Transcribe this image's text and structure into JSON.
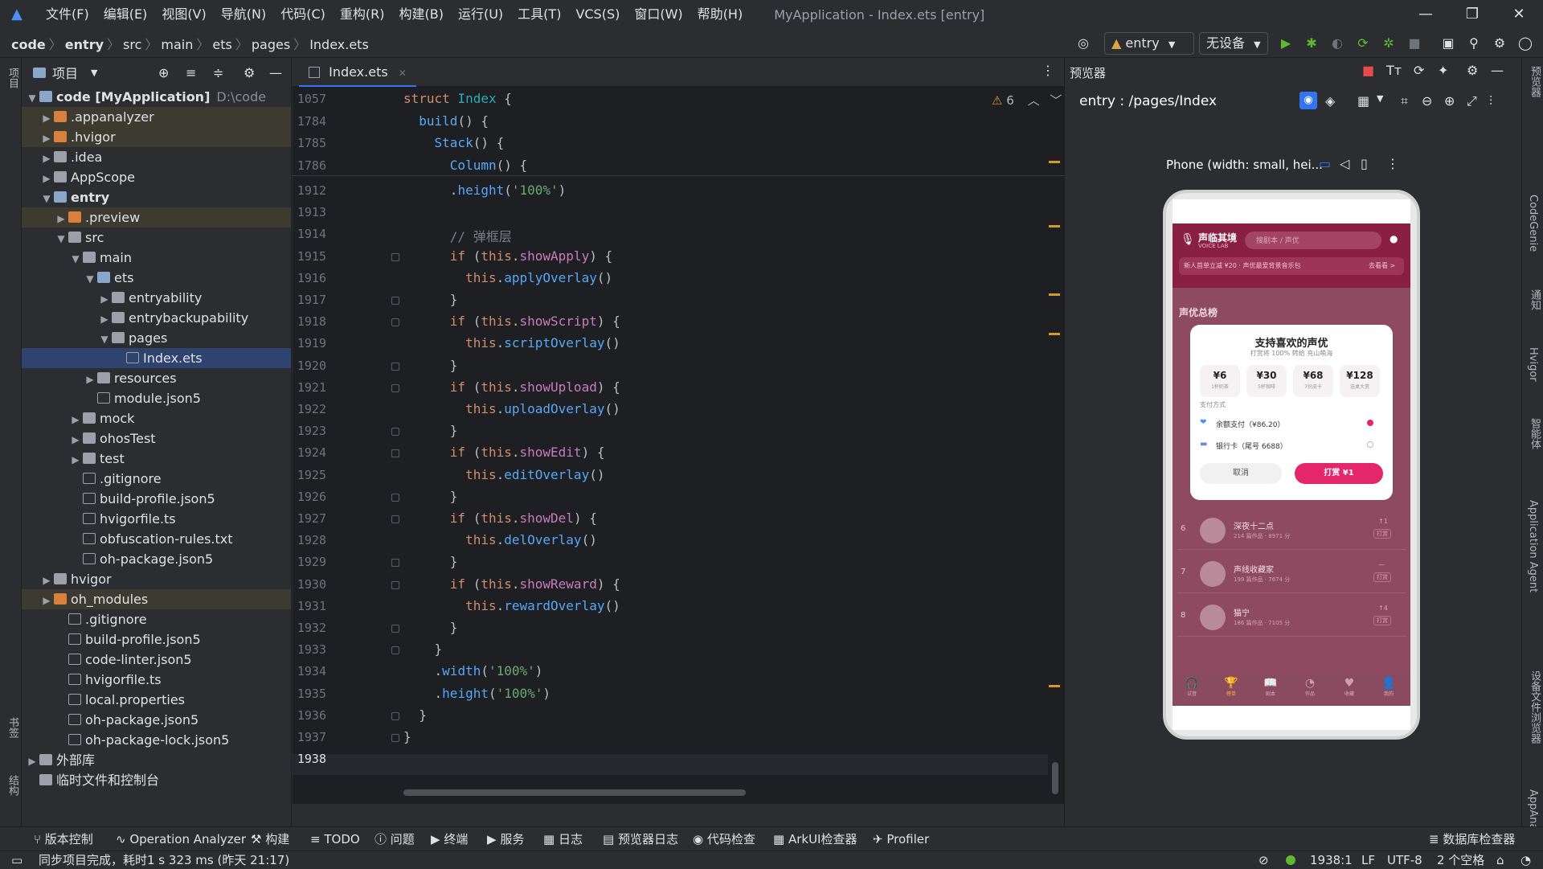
{
  "menu": [
    "文件(F)",
    "编辑(E)",
    "视图(V)",
    "导航(N)",
    "代码(C)",
    "重构(R)",
    "构建(B)",
    "运行(U)",
    "工具(T)",
    "VCS(S)",
    "窗口(W)",
    "帮助(H)"
  ],
  "window_title": "MyApplication - Index.ets [entry]",
  "breadcrumb": [
    "code",
    "entry",
    "src",
    "main",
    "ets",
    "pages",
    "Index.ets"
  ],
  "toolbar": {
    "module": "entry",
    "device": "无设备"
  },
  "project": {
    "title": "项目",
    "tree": [
      {
        "label": "code [MyApplication]",
        "path": "D:\\code",
        "depth": 0,
        "arrow": "▼",
        "icon": "fold-blue",
        "bold": true
      },
      {
        "label": ".appanalyzer",
        "depth": 1,
        "arrow": "▶",
        "icon": "fold-orange",
        "hl": true
      },
      {
        "label": ".hvigor",
        "depth": 1,
        "arrow": "▶",
        "icon": "fold-orange",
        "hl": true
      },
      {
        "label": ".idea",
        "depth": 1,
        "arrow": "▶",
        "icon": "fold-gray"
      },
      {
        "label": "AppScope",
        "depth": 1,
        "arrow": "▶",
        "icon": "fold-gray"
      },
      {
        "label": "entry",
        "depth": 1,
        "arrow": "▼",
        "icon": "fold-blue",
        "bold": true
      },
      {
        "label": ".preview",
        "depth": 2,
        "arrow": "▶",
        "icon": "fold-orange",
        "hl": true
      },
      {
        "label": "src",
        "depth": 2,
        "arrow": "▼",
        "icon": "fold-gray"
      },
      {
        "label": "main",
        "depth": 3,
        "arrow": "▼",
        "icon": "fold-gray"
      },
      {
        "label": "ets",
        "depth": 4,
        "arrow": "▼",
        "icon": "fold-blue"
      },
      {
        "label": "entryability",
        "depth": 5,
        "arrow": "▶",
        "icon": "fold-gray"
      },
      {
        "label": "entrybackupability",
        "depth": 5,
        "arrow": "▶",
        "icon": "fold-gray"
      },
      {
        "label": "pages",
        "depth": 5,
        "arrow": "▼",
        "icon": "fold-gray"
      },
      {
        "label": "Index.ets",
        "depth": 6,
        "arrow": "",
        "icon": "file",
        "sel": true
      },
      {
        "label": "resources",
        "depth": 4,
        "arrow": "▶",
        "icon": "fold-gray"
      },
      {
        "label": "module.json5",
        "depth": 4,
        "arrow": "",
        "icon": "file"
      },
      {
        "label": "mock",
        "depth": 3,
        "arrow": "▶",
        "icon": "fold-gray"
      },
      {
        "label": "ohosTest",
        "depth": 3,
        "arrow": "▶",
        "icon": "fold-gray"
      },
      {
        "label": "test",
        "depth": 3,
        "arrow": "▶",
        "icon": "fold-gray"
      },
      {
        "label": ".gitignore",
        "depth": 3,
        "arrow": "",
        "icon": "file"
      },
      {
        "label": "build-profile.json5",
        "depth": 3,
        "arrow": "",
        "icon": "file"
      },
      {
        "label": "hvigorfile.ts",
        "depth": 3,
        "arrow": "",
        "icon": "file"
      },
      {
        "label": "obfuscation-rules.txt",
        "depth": 3,
        "arrow": "",
        "icon": "file"
      },
      {
        "label": "oh-package.json5",
        "depth": 3,
        "arrow": "",
        "icon": "file"
      },
      {
        "label": "hvigor",
        "depth": 1,
        "arrow": "▶",
        "icon": "fold-gray"
      },
      {
        "label": "oh_modules",
        "depth": 1,
        "arrow": "▶",
        "icon": "fold-orange",
        "hl": true
      },
      {
        "label": ".gitignore",
        "depth": 2,
        "arrow": "",
        "icon": "file"
      },
      {
        "label": "build-profile.json5",
        "depth": 2,
        "arrow": "",
        "icon": "file"
      },
      {
        "label": "code-linter.json5",
        "depth": 2,
        "arrow": "",
        "icon": "file"
      },
      {
        "label": "hvigorfile.ts",
        "depth": 2,
        "arrow": "",
        "icon": "file"
      },
      {
        "label": "local.properties",
        "depth": 2,
        "arrow": "",
        "icon": "file"
      },
      {
        "label": "oh-package.json5",
        "depth": 2,
        "arrow": "",
        "icon": "file"
      },
      {
        "label": "oh-package-lock.json5",
        "depth": 2,
        "arrow": "",
        "icon": "file"
      },
      {
        "label": "外部库",
        "depth": 0,
        "arrow": "▶",
        "icon": "fold-gray"
      },
      {
        "label": "临时文件和控制台",
        "depth": 0,
        "arrow": "",
        "icon": "fold-gray"
      }
    ]
  },
  "editor": {
    "tab": "Index.ets",
    "warnings": "6",
    "sticky": [
      {
        "ln": "1057",
        "html": "<span class='kw'>struct</span> <span class='ty'>Index</span> {"
      },
      {
        "ln": "1784",
        "html": "  <span class='fn'>build</span>() {"
      },
      {
        "ln": "1785",
        "html": "    <span class='fn'>Stack</span>() {"
      },
      {
        "ln": "1786",
        "html": "      <span class='fn'>Column</span>() {"
      }
    ],
    "lines": [
      {
        "ln": "1912",
        "html": "      .<span class='fn2'>height</span>(<span class='str'>'100%'</span>)"
      },
      {
        "ln": "1913",
        "html": ""
      },
      {
        "ln": "1914",
        "html": "      <span class='cm'>// 弹框层</span>"
      },
      {
        "ln": "1915",
        "html": "      <span class='kw'>if</span> (<span class='this'>this</span>.<span class='prop'>showApply</span>) {"
      },
      {
        "ln": "1916",
        "html": "        <span class='this'>this</span>.<span class='fn2'>applyOverlay</span>()"
      },
      {
        "ln": "1917",
        "html": "      }"
      },
      {
        "ln": "1918",
        "html": "      <span class='kw'>if</span> (<span class='this'>this</span>.<span class='prop'>showScript</span>) {"
      },
      {
        "ln": "1919",
        "html": "        <span class='this'>this</span>.<span class='fn2'>scriptOverlay</span>()"
      },
      {
        "ln": "1920",
        "html": "      }"
      },
      {
        "ln": "1921",
        "html": "      <span class='kw'>if</span> (<span class='this'>this</span>.<span class='prop'>showUpload</span>) {"
      },
      {
        "ln": "1922",
        "html": "        <span class='this'>this</span>.<span class='fn2'>uploadOverlay</span>()"
      },
      {
        "ln": "1923",
        "html": "      }"
      },
      {
        "ln": "1924",
        "html": "      <span class='kw'>if</span> (<span class='this'>this</span>.<span class='prop'>showEdit</span>) {"
      },
      {
        "ln": "1925",
        "html": "        <span class='this'>this</span>.<span class='fn2'>editOverlay</span>()"
      },
      {
        "ln": "1926",
        "html": "      }"
      },
      {
        "ln": "1927",
        "html": "      <span class='kw'>if</span> (<span class='this'>this</span>.<span class='prop'>showDel</span>) {"
      },
      {
        "ln": "1928",
        "html": "        <span class='this'>this</span>.<span class='fn2'>delOverlay</span>()"
      },
      {
        "ln": "1929",
        "html": "      }"
      },
      {
        "ln": "1930",
        "html": "      <span class='kw'>if</span> (<span class='this'>this</span>.<span class='prop'>showReward</span>) {"
      },
      {
        "ln": "1931",
        "html": "        <span class='this'>this</span>.<span class='fn2'>rewardOverlay</span>()"
      },
      {
        "ln": "1932",
        "html": "      }"
      },
      {
        "ln": "1933",
        "html": "    }"
      },
      {
        "ln": "1934",
        "html": "    .<span class='fn2'>width</span>(<span class='str'>'100%'</span>)"
      },
      {
        "ln": "1935",
        "html": "    .<span class='fn2'>height</span>(<span class='str'>'100%'</span>)"
      },
      {
        "ln": "1936",
        "html": "  }"
      },
      {
        "ln": "1937",
        "html": "}"
      },
      {
        "ln": "1938",
        "html": ""
      }
    ]
  },
  "preview": {
    "title": "预览器",
    "route": "entry : /pages/Index",
    "device": "Phone (width: small, hei...",
    "app": {
      "name": "声临其境",
      "sub": "VOICE LAB",
      "search": "搜剧本 / 声优",
      "banner": "新人首单立减 ¥20 · 声优最爱背景音乐包",
      "banner_action": "去看看 >",
      "section": "声优总榜",
      "dialog_title": "支持喜欢的声优",
      "dialog_sub": "打赏将 100% 转给 充山萌海",
      "amounts": [
        {
          "v": "¥6",
          "s": "1杯奶茶"
        },
        {
          "v": "¥30",
          "s": "5杯咖啡"
        },
        {
          "v": "¥68",
          "s": "7份皮卡"
        },
        {
          "v": "¥128",
          "s": "送桌大赏"
        }
      ],
      "pay_label": "支付方式",
      "pay1": "余额支付（¥86.20）",
      "pay2": "银行卡（尾号 6688）",
      "cancel": "取消",
      "confirm": "打赏 ¥1",
      "rows": [
        {
          "rank": "6",
          "name": "深夜十二点",
          "meta": "214 篇作品 · 8971 分",
          "badge": "打赏",
          "up": "↑1"
        },
        {
          "rank": "7",
          "name": "声线收藏家",
          "meta": "199 篇作品 · 7674 分",
          "badge": "打赏",
          "up": "—"
        },
        {
          "rank": "8",
          "name": "猫宁",
          "meta": "186 篇作品 · 7105 分",
          "badge": "打赏",
          "up": "↑4"
        }
      ],
      "nav": [
        "试音",
        "榜单",
        "剧本",
        "作品",
        "收藏",
        "我的"
      ]
    }
  },
  "toolwindows": [
    "版本控制",
    "Operation Analyzer",
    "构建",
    "TODO",
    "问题",
    "终端",
    "服务",
    "日志",
    "预览器日志",
    "代码检查",
    "ArkUI检查器",
    "Profiler",
    "数据库检查器"
  ],
  "status": {
    "message": "同步项目完成，耗时1 s 323 ms (昨天 21:17)",
    "pos": "1938:1",
    "lf": "LF",
    "enc": "UTF-8",
    "indent": "2 个空格"
  },
  "side_right": [
    "预览器",
    "CodeGenie",
    "通知",
    "Hvigor",
    "智能体",
    "Application Agent",
    "设备文件浏览器",
    "AppAnalyzer"
  ],
  "side_left": [
    "项目",
    "书签",
    "结构"
  ]
}
